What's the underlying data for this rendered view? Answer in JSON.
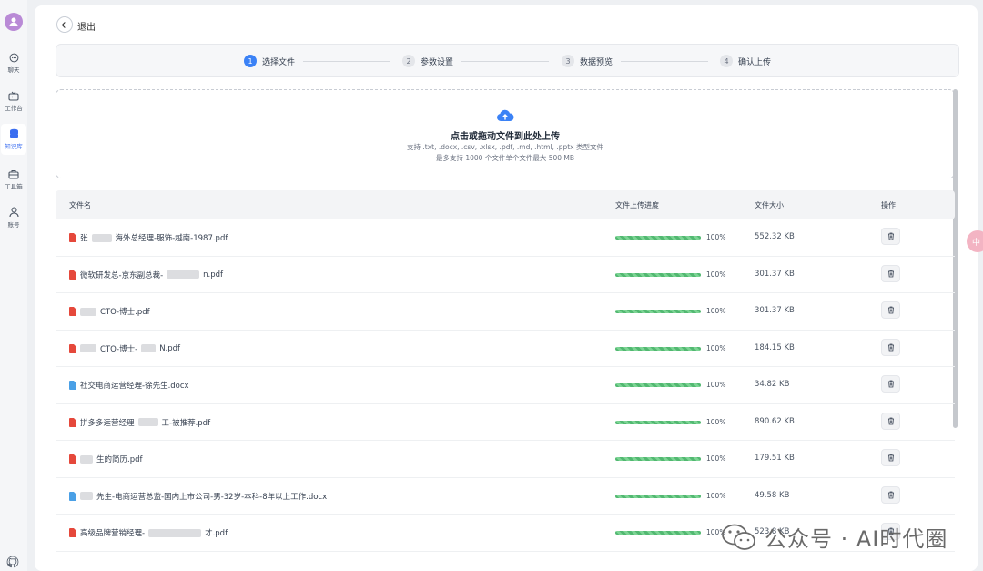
{
  "sidebar": {
    "items": [
      {
        "label": "聊天",
        "icon": "chat-icon"
      },
      {
        "label": "工作台",
        "icon": "tv-icon"
      },
      {
        "label": "知识库",
        "icon": "database-icon",
        "active": true
      },
      {
        "label": "工具箱",
        "icon": "toolbox-icon"
      },
      {
        "label": "账号",
        "icon": "user-icon"
      }
    ],
    "bottom_icon": "github-icon"
  },
  "header": {
    "back_label": "退出"
  },
  "steps": [
    {
      "num": "1",
      "label": "选择文件",
      "active": true
    },
    {
      "num": "2",
      "label": "参数设置",
      "active": false
    },
    {
      "num": "3",
      "label": "数据预览",
      "active": false
    },
    {
      "num": "4",
      "label": "确认上传",
      "active": false
    }
  ],
  "upload": {
    "icon": "cloud-upload-icon",
    "title": "点击或拖动文件到此处上传",
    "hint1": "支持 .txt, .docx, .csv, .xlsx, .pdf, .md, .html, .pptx 类型文件",
    "hint2": "最多支持 1000 个文件单个文件最大 500 MB"
  },
  "table": {
    "columns": [
      "文件名",
      "文件上传进度",
      "文件大小",
      "操作"
    ],
    "rows": [
      {
        "type": "pdf",
        "name_a": "张",
        "name_b": "海外总经理-服饰-越南-1987.pdf",
        "progress": "100%",
        "size": "552.32 KB"
      },
      {
        "type": "pdf",
        "name_a": "微软研发总-京东副总裁-",
        "name_b": "n.pdf",
        "progress": "100%",
        "size": "301.37 KB"
      },
      {
        "type": "pdf",
        "name_a": "",
        "name_b": "CTO-博士.pdf",
        "progress": "100%",
        "size": "301.37 KB"
      },
      {
        "type": "pdf",
        "name_a": "",
        "name_b": "CTO-博士-",
        "name_c": "N.pdf",
        "progress": "100%",
        "size": "184.15 KB"
      },
      {
        "type": "docx",
        "name_a": "社交电商运营经理-徐先生.docx",
        "name_b": "",
        "progress": "100%",
        "size": "34.82 KB"
      },
      {
        "type": "pdf",
        "name_a": "拼多多运营经理",
        "name_b": "工-被推荐.pdf",
        "progress": "100%",
        "size": "890.62 KB"
      },
      {
        "type": "pdf",
        "name_a": "",
        "name_b": "生的简历.pdf",
        "progress": "100%",
        "size": "179.51 KB"
      },
      {
        "type": "docx",
        "name_a": "",
        "name_b": "先生-电商运营总监-国内上市公司-男-32岁-本科-8年以上工作.docx",
        "progress": "100%",
        "size": "49.58 KB"
      },
      {
        "type": "pdf",
        "name_a": "高级品牌营销经理-",
        "name_b": "才.pdf",
        "progress": "100%",
        "size": "523.8 KB"
      }
    ]
  },
  "watermark": {
    "text": "公众号 · AI时代圈"
  },
  "right_badge": {
    "text": "中"
  }
}
